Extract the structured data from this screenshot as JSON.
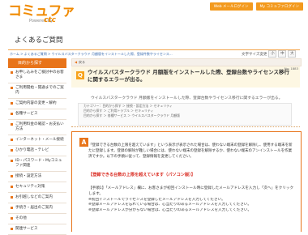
{
  "header": {
    "logo": "コミュファ",
    "logo_sub": "Powered by",
    "logo_brand": "ctc",
    "btn_login": "Web メールログイン",
    "btn_mypage": "My コミュファログイン"
  },
  "page_title": "よくあるご質問",
  "breadcrumb": "ホーム > よくあるご質問 > ウイルスバスタークラウド 月額版をインストールした際、登録件数やライセンス…",
  "font_size": {
    "label": "文字サイズ変更",
    "small": "小",
    "medium": "中",
    "large": "大"
  },
  "sidebar": {
    "heading": "目的から探す",
    "items": [
      "お申し込みをご検討中のお客さま",
      "ご利用開始・開通までのご案内",
      "ご契約内容の変更・解約",
      "各種サービス",
      "ご利用料金の確認・お支払い方法",
      "インターネット・メール接続",
      "ひかり電話・テレビ",
      "ID・パスワード・Myコミュファ関連",
      "接続・設定方法",
      "セキュリティ対策",
      "お引越しなどのご案内",
      "手続き・届出のご案内",
      "その他"
    ],
    "footer_item": "関連サービス"
  },
  "back_label": "戻る",
  "question": {
    "badge": "Q",
    "text": "ウイルスバスタークラウド 月額版をインストールした際、登録台数やライセンス移行に関するエラーが出る。",
    "number": "No: 1883"
  },
  "summary": "ウイルスバスタークラウド 月額版をインストールした際、登録台数やライセンス移行に関するエラーが出る。",
  "categories": [
    "カテゴリー：目的から探す ＞ 接続・設定方法 ＞ セキュリティ",
    "目的から探す ＞ ご利用トラブル ＞ セキュリティ",
    "目的から探す ＞ 各種サービス ＞ ウイルスバスタークラウド 月額版"
  ],
  "answer": {
    "badge": "A",
    "para": "「登録できる台数の上限を超えています」という表示が表示された場合は、使わない端末の登録を解除し、使用する端末を新たに登録します。登録の解除が難しい場合には、使わない端末の登録を解除するか、使わない端末のアンインストールを作業済ですか。以下の手順に従って、登録情報を変更してください。",
    "red_heading": "【登録できる台数の上限を超えています（パソコン版）】",
    "steps": [
      "【手順1】「メールアドレス」欄に、お客さまが初回インストール時に登録したメールアドレスを入力し「次へ」をクリックします。",
      "※初回インストールでライセンスを登録したメールアドレスを入力してください。",
      "※登録メールアドレスを忘れている場合は、心当たりのあるメールアドレスを入力してください。",
      "※登録メールアドレスが分からない場合は、心当たりのあるメールアドレスを入力してください。"
    ]
  }
}
